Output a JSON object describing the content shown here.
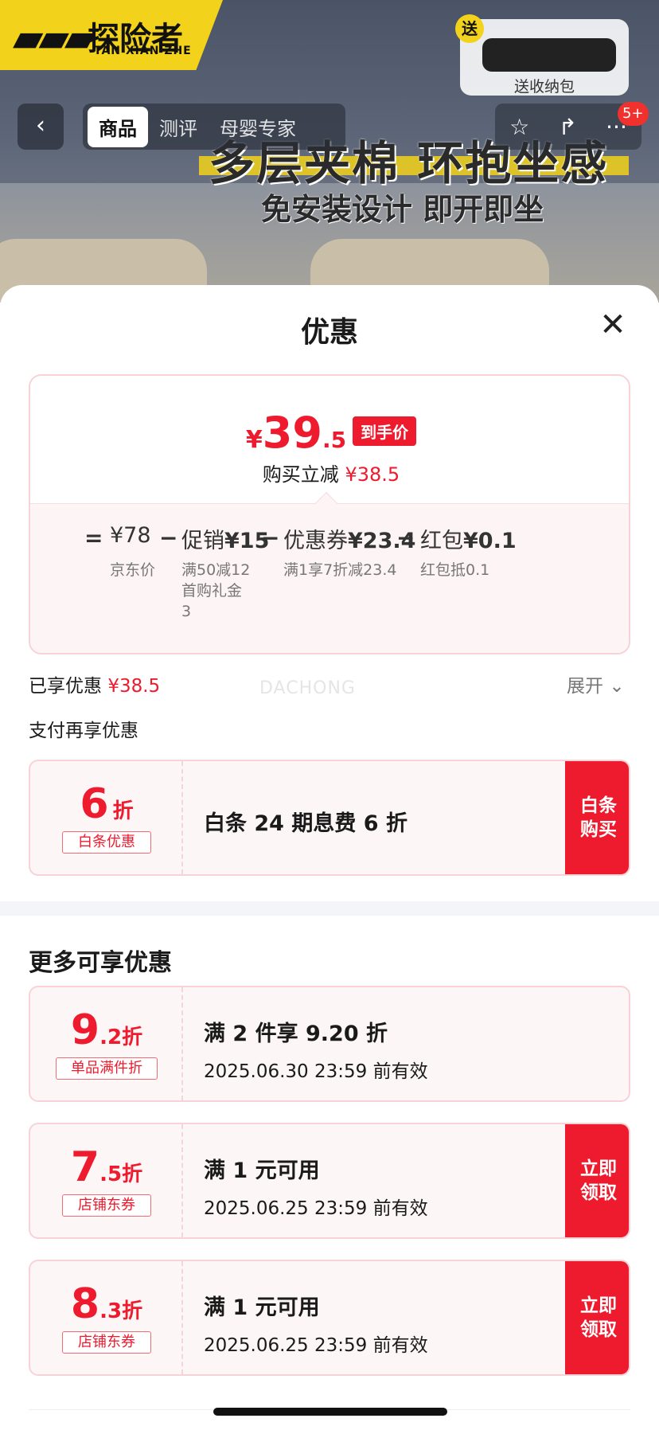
{
  "background": {
    "logo_mark": "▰▰▰",
    "logo_text": "探险者",
    "logo_sub": "TAN XIAN ZHE",
    "gift_tag": "送",
    "gift_label": "送收纳包",
    "slogan_main": "多层夹棉 环抱坐感",
    "slogan_sub": "免安装设计 即开即坐"
  },
  "nav": {
    "back_glyph": "‹",
    "tabs": [
      {
        "label": "商品",
        "active": true
      },
      {
        "label": "测评"
      },
      {
        "label": "母婴专家"
      }
    ],
    "star_glyph": "☆",
    "share_glyph": "↱",
    "more_glyph": "···",
    "badge": "5+"
  },
  "sheet": {
    "title": "优惠",
    "close_glyph": "✕"
  },
  "price": {
    "currency": "¥",
    "integer": "39",
    "decimal": ".5",
    "tag": "到手价",
    "reduction_label": "购买立减",
    "reduction_value": "¥38.5"
  },
  "formula": {
    "equals": "=",
    "minus": "−",
    "base": {
      "label": "¥78",
      "sub": "京东价"
    },
    "items": [
      {
        "label_prefix": "促销",
        "label_value": "¥15",
        "sub": "满50减12\n首购礼金\n3"
      },
      {
        "label_prefix": "优惠券",
        "label_value": "¥23.4",
        "sub": "满1享7折减23.4"
      },
      {
        "label_prefix": "红包",
        "label_value": "¥0.1",
        "sub": "红包抵0.1"
      }
    ]
  },
  "enjoyed": {
    "label": "已享优惠",
    "value": "¥38.5",
    "expand_label": "展开",
    "expand_glyph": "⌄"
  },
  "pay_more_title": "支付再享优惠",
  "watermark": "DACHONG",
  "baitiao": {
    "rate_big": "6",
    "rate_unit": "折",
    "label": "白条优惠",
    "title": "白条 24 期息费 6 折",
    "button": "白条\n购买"
  },
  "more_title": "更多可享优惠",
  "coupons": [
    {
      "rate_big": "9",
      "rate_small": ".2",
      "rate_unit": "折",
      "label": "单品满件折",
      "title": "满 2 件享 9.20 折",
      "date": "2025.06.30 23:59 前有效",
      "button": ""
    },
    {
      "rate_big": "7",
      "rate_small": ".5",
      "rate_unit": "折",
      "label": "店铺东券",
      "title": "满 1 元可用",
      "date": "2025.06.25 23:59 前有效",
      "button": "立即\n领取"
    },
    {
      "rate_big": "8",
      "rate_small": ".3",
      "rate_unit": "折",
      "label": "店铺东券",
      "title": "满 1 元可用",
      "date": "2025.06.25 23:59 前有效",
      "button": "立即\n领取"
    }
  ],
  "colors": {
    "accent_red": "#ee1b2e",
    "brand_yellow": "#f2d21a"
  }
}
